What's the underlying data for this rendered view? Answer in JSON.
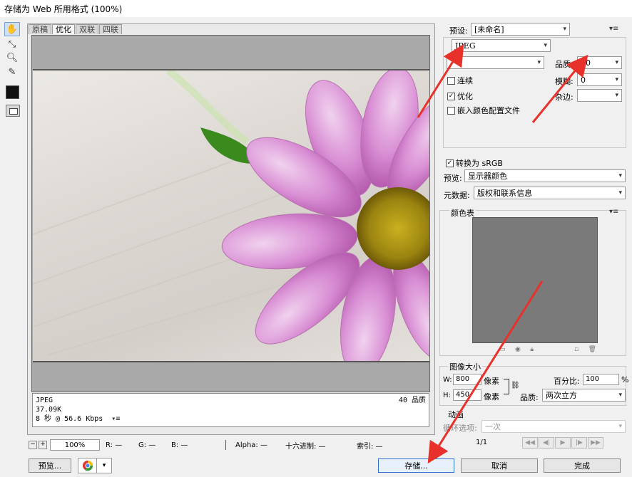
{
  "window": {
    "title": "存储为 Web 所用格式 (100%)"
  },
  "tools": [
    "hand-icon",
    "slice-select-icon",
    "zoom-icon",
    "eyedropper-icon"
  ],
  "tabs": [
    "原稿",
    "优化",
    "双联",
    "四联"
  ],
  "image_info": {
    "format": "JPEG",
    "size": "37.09K",
    "speed": "8 秒 @ 56.6 Kbps",
    "quality": "40 品质"
  },
  "status": {
    "zoom": "100%",
    "r": "R: —",
    "g": "G: —",
    "b": "B: —",
    "alpha": "Alpha: —",
    "hex": "十六进制: —",
    "index": "索引: —",
    "frame": "1/1"
  },
  "settings": {
    "preset_label": "预设:",
    "preset_value": "[未命名]",
    "format": "JPEG",
    "quality_preset": "",
    "quality_label": "品质:",
    "quality_value": "40",
    "progressive": "连续",
    "optimized": "优化",
    "embed_profile": "嵌入颜色配置文件",
    "blur_label": "模糊:",
    "blur_value": "0",
    "matte_label": "杂边:",
    "convert_srgb": "转换为 sRGB",
    "preview_label": "预览:",
    "preview_value": "显示器颜色",
    "metadata_label": "元数据:",
    "metadata_value": "版权和联系信息",
    "color_table": "颜色表"
  },
  "image_size": {
    "title": "图像大小",
    "w_label": "W:",
    "w_value": "800",
    "h_label": "H:",
    "h_value": "450",
    "unit": "像素",
    "percent_label": "百分比:",
    "percent_value": "100",
    "percent_unit": "%",
    "quality_label": "品质:",
    "quality_value": "两次立方"
  },
  "animation": {
    "title": "动画",
    "loop_label": "循环选项:",
    "loop_value": "一次"
  },
  "buttons": {
    "preview": "预览...",
    "save": "存储...",
    "cancel": "取消",
    "done": "完成"
  },
  "colors": {
    "annotation_arrow": "#e8312a",
    "focus_blue": "#2f6fd0"
  }
}
